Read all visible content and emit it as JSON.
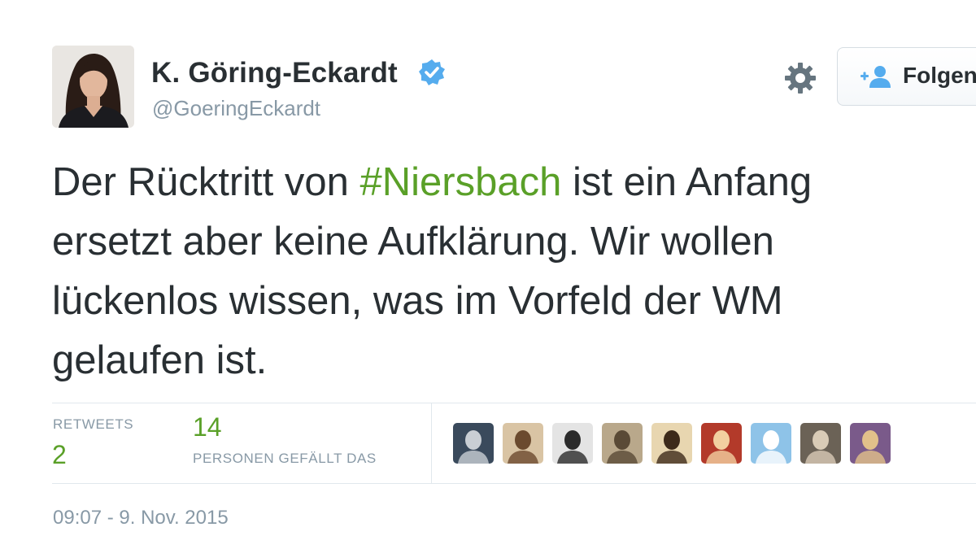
{
  "user": {
    "fullname": "K. Göring-Eckardt",
    "handle": "@GoeringEckardt",
    "verified": true
  },
  "actions": {
    "settings_icon": "gear-icon",
    "follow_label": "Folgen"
  },
  "tweet": {
    "lines": [
      {
        "before": "Der Rücktritt von ",
        "hashtag": "#Niersbach",
        "after": " ist ein Anfang"
      },
      {
        "text": "ersetzt aber keine Aufklärung. Wir wollen"
      },
      {
        "text": "lückenlos wissen, was im Vorfeld der WM"
      },
      {
        "text": "gelaufen ist."
      }
    ]
  },
  "stats": {
    "retweets_label": "RETWEETS",
    "retweets_value": "2",
    "likes_value": "14",
    "likes_label": "PERSONEN GEFÄLLT DAS"
  },
  "likers": [
    {
      "name": "liker-avatar-1",
      "bg": "#3a4a5c",
      "fg": "#c9ced4"
    },
    {
      "name": "liker-avatar-2",
      "bg": "#d9c4a4",
      "fg": "#6b4a2e"
    },
    {
      "name": "liker-avatar-3",
      "bg": "#e4e4e4",
      "fg": "#2b2b2b"
    },
    {
      "name": "liker-avatar-4",
      "bg": "#b9a88b",
      "fg": "#5a4a36"
    },
    {
      "name": "liker-avatar-5",
      "bg": "#e8d6b0",
      "fg": "#3d2a1a"
    },
    {
      "name": "liker-avatar-6",
      "bg": "#b33a2a",
      "fg": "#f2d0a0"
    },
    {
      "name": "liker-avatar-7",
      "bg": "#8ec3e8",
      "fg": "#ffffff"
    },
    {
      "name": "liker-avatar-8",
      "bg": "#6b6256",
      "fg": "#d9cbb6"
    },
    {
      "name": "liker-avatar-9",
      "bg": "#7a5a8a",
      "fg": "#e2c08a"
    }
  ],
  "timestamp": "09:07 - 9. Nov. 2015",
  "colors": {
    "accent": "#5aa028",
    "text": "#292f33",
    "muted": "#8899a6",
    "verified": "#55acee"
  }
}
